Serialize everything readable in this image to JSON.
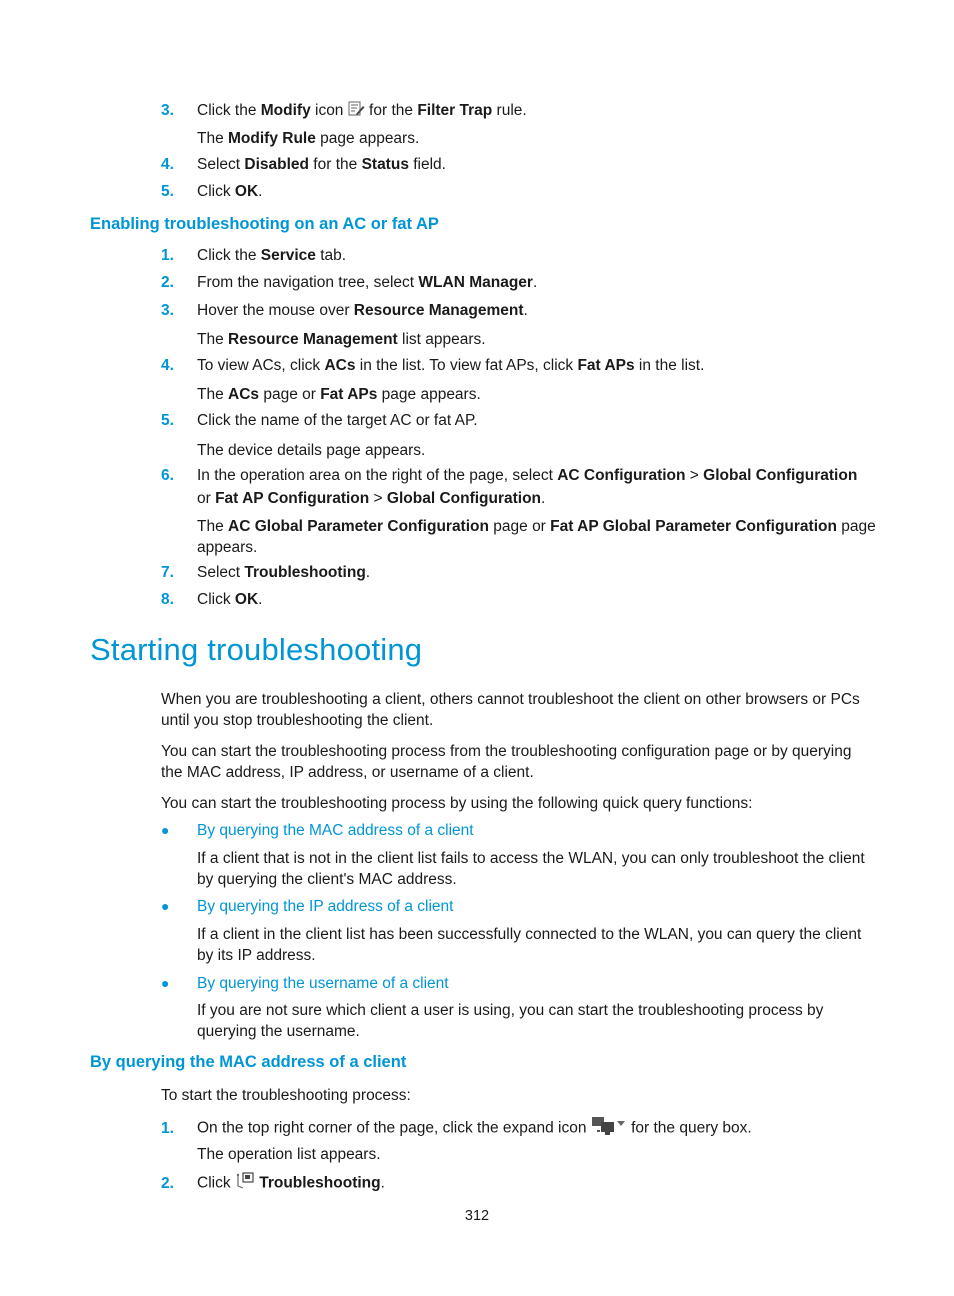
{
  "colors": {
    "accent": "#0096d6",
    "text": "#1a1a1a"
  },
  "top_steps": [
    {
      "num": "3.",
      "pre": "Click the ",
      "b1": "Modify",
      "mid1": " icon ",
      "icon": "modify-icon",
      "mid2": " for the ",
      "b2": "Filter Trap",
      "post": " rule."
    },
    {
      "sub_pre": "The ",
      "sub_b": "Modify Rule",
      "sub_post": " page appears."
    },
    {
      "num": "4.",
      "pre": "Select ",
      "b1": "Disabled",
      "mid": " for the ",
      "b2": "Status",
      "post": " field."
    },
    {
      "num": "5.",
      "pre": "Click ",
      "b1": "OK",
      "post": "."
    }
  ],
  "section1": {
    "title": "Enabling troubleshooting on an AC or fat AP",
    "steps": {
      "s1": {
        "num": "1.",
        "pre": "Click the ",
        "b1": "Service",
        "post": " tab."
      },
      "s2": {
        "num": "2.",
        "pre": "From the navigation tree, select ",
        "b1": "WLAN Manager",
        "post": "."
      },
      "s3": {
        "num": "3.",
        "pre": "Hover the mouse over ",
        "b1": "Resource Management",
        "post": "."
      },
      "s3sub": {
        "pre": "The ",
        "b1": "Resource Management",
        "post": " list appears."
      },
      "s4": {
        "num": "4.",
        "pre": "To view ACs, click ",
        "b1": "ACs",
        "mid": " in the list. To view fat APs, click ",
        "b2": "Fat APs",
        "post": " in the list."
      },
      "s4sub": {
        "pre": "The ",
        "b1": "ACs",
        "mid": " page or ",
        "b2": "Fat APs",
        "post": " page appears."
      },
      "s5": {
        "num": "5.",
        "text": "Click the name of the target AC or fat AP."
      },
      "s5sub": {
        "text": "The device details page appears."
      },
      "s6": {
        "num": "6.",
        "pre": "In the operation area on the right of the page, select ",
        "b1": "AC Configuration",
        "sep1": " > ",
        "b2": "Global Configuration",
        "line2_pre": "or ",
        "b3": "Fat AP Configuration",
        "sep2": " > ",
        "b4": "Global Configuration",
        "post": "."
      },
      "s6sub": {
        "pre": "The ",
        "b1": "AC Global Parameter Configuration",
        "mid": " page or ",
        "b2": "Fat AP Global Parameter Configuration",
        "post": " page",
        "line2": "appears."
      },
      "s7": {
        "num": "7.",
        "pre": "Select ",
        "b1": "Troubleshooting",
        "post": "."
      },
      "s8": {
        "num": "8.",
        "pre": "Click ",
        "b1": "OK",
        "post": "."
      }
    }
  },
  "section2": {
    "title": "Starting troubleshooting",
    "p1": "When you are troubleshooting a client, others cannot troubleshoot the client on other browsers or PCs until you stop troubleshooting the client.",
    "p2": "You can start the troubleshooting process from the troubleshooting configuration page or by querying the MAC address, IP address, or username of a client.",
    "p3": "You can start the troubleshooting process by using the following quick query functions:",
    "bullets": [
      {
        "link": "By querying the MAC address of a client",
        "desc": "If a client that is not in the client list fails to access the WLAN, you can only troubleshoot the client by querying the client's MAC address."
      },
      {
        "link": "By querying the IP address of a client",
        "desc": "If a client in the client list has been successfully connected to the WLAN, you can query the client by its IP address."
      },
      {
        "link": "By querying the username of a client",
        "desc": "If you are not sure which client a user is using, you can start the troubleshooting process by querying the username."
      }
    ]
  },
  "section3": {
    "title": "By querying the MAC address of a client",
    "intro": "To start the troubleshooting process:",
    "s1": {
      "num": "1.",
      "pre": "On the top right corner of the page, click the expand icon ",
      "icon": "expand-query-icon",
      "post": " for the query box."
    },
    "s1sub": "The operation list appears.",
    "s2": {
      "num": "2.",
      "pre": "Click ",
      "icon": "troubleshooting-icon",
      "b1": "Troubleshooting",
      "post": "."
    }
  },
  "page_number": "312"
}
